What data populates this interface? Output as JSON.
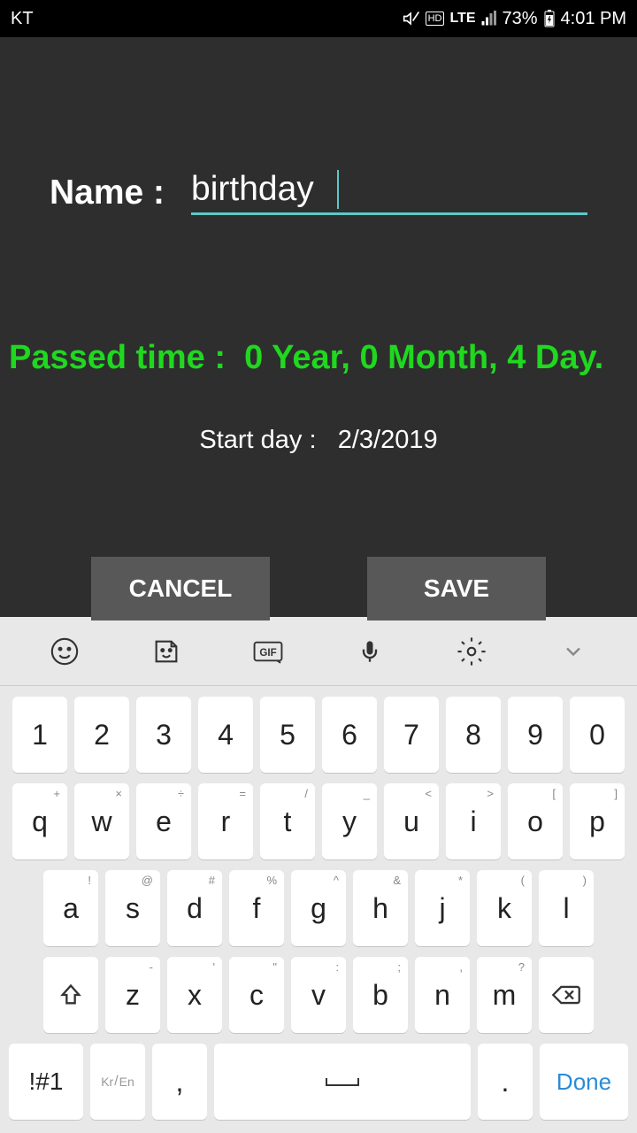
{
  "status_bar": {
    "carrier": "KT",
    "network": "LTE",
    "battery": "73%",
    "time": "4:01 PM"
  },
  "form": {
    "name_label": "Name :",
    "name_value": "birthday",
    "passed_time_label": "Passed time :",
    "passed_time_value": "0 Year, 0 Month, 4 Day.",
    "start_day_label": "Start day :",
    "start_day_value": "2/3/2019",
    "cancel_label": "CANCEL",
    "save_label": "SAVE"
  },
  "keyboard": {
    "row1": [
      "1",
      "2",
      "3",
      "4",
      "5",
      "6",
      "7",
      "8",
      "9",
      "0"
    ],
    "row2": [
      {
        "main": "q",
        "hint": "+"
      },
      {
        "main": "w",
        "hint": "×"
      },
      {
        "main": "e",
        "hint": "÷"
      },
      {
        "main": "r",
        "hint": "="
      },
      {
        "main": "t",
        "hint": "/"
      },
      {
        "main": "y",
        "hint": "_"
      },
      {
        "main": "u",
        "hint": "<"
      },
      {
        "main": "i",
        "hint": ">"
      },
      {
        "main": "o",
        "hint": "["
      },
      {
        "main": "p",
        "hint": "]"
      }
    ],
    "row3": [
      {
        "main": "a",
        "hint": "!"
      },
      {
        "main": "s",
        "hint": "@"
      },
      {
        "main": "d",
        "hint": "#"
      },
      {
        "main": "f",
        "hint": "%"
      },
      {
        "main": "g",
        "hint": "^"
      },
      {
        "main": "h",
        "hint": "&"
      },
      {
        "main": "j",
        "hint": "*"
      },
      {
        "main": "k",
        "hint": "("
      },
      {
        "main": "l",
        "hint": ")"
      }
    ],
    "row4": [
      {
        "main": "z",
        "hint": "-"
      },
      {
        "main": "x",
        "hint": "'"
      },
      {
        "main": "c",
        "hint": "\""
      },
      {
        "main": "v",
        "hint": ":"
      },
      {
        "main": "b",
        "hint": ";"
      },
      {
        "main": "n",
        "hint": ","
      },
      {
        "main": "m",
        "hint": "?"
      }
    ],
    "sym": "!#1",
    "lang": "Kr/En",
    "comma": ",",
    "period": ".",
    "done": "Done"
  }
}
